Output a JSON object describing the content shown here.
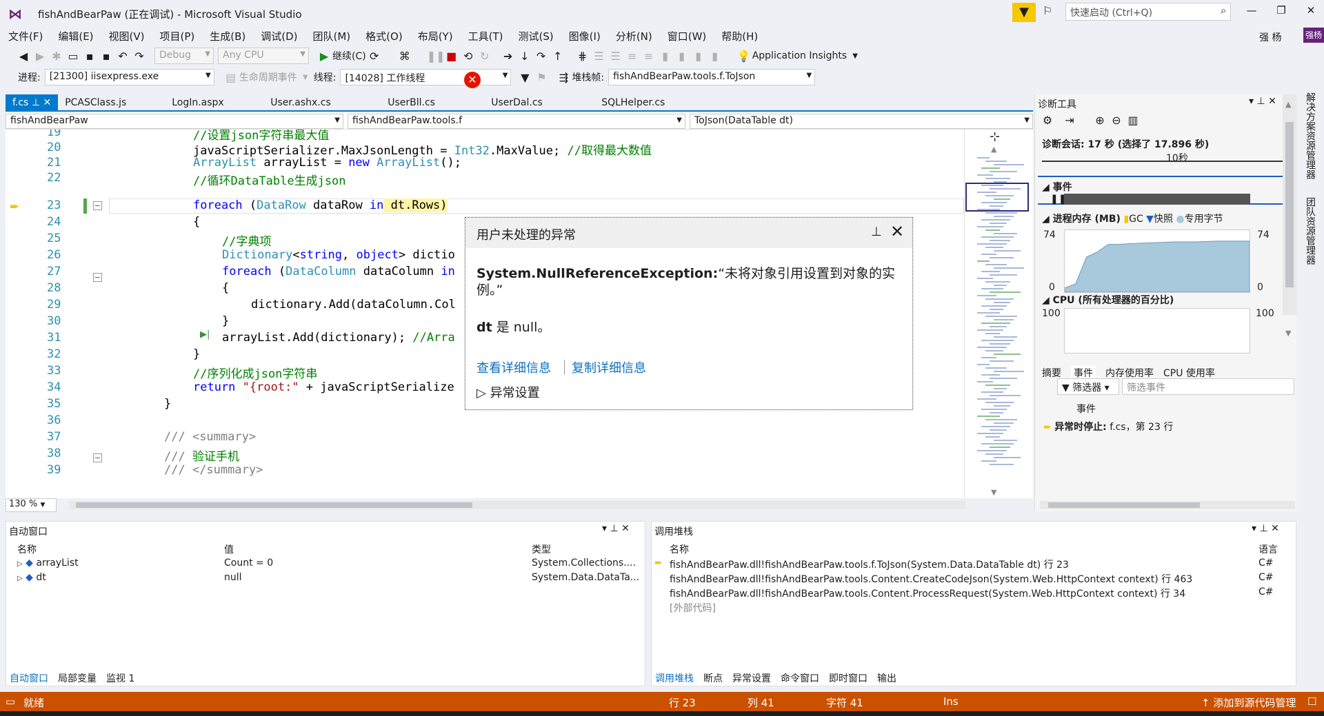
{
  "window": {
    "title": "fishAndBearPaw (正在调试) - Microsoft Visual Studio",
    "quick_launch_placeholder": "快速启动 (Ctrl+Q)",
    "user": "强 杨",
    "user_badge": "强杨"
  },
  "menu": [
    "文件(F)",
    "编辑(E)",
    "视图(V)",
    "项目(P)",
    "生成(B)",
    "调试(D)",
    "团队(M)",
    "格式(O)",
    "布局(Y)",
    "工具(T)",
    "测试(S)",
    "图像(I)",
    "分析(N)",
    "窗口(W)",
    "帮助(H)"
  ],
  "toolbar": {
    "config": "Debug",
    "platform": "Any CPU",
    "continue_label": "继续(C)",
    "app_insights": "Application Insights",
    "process_label": "进程:",
    "process_value": "[21300] iisexpress.exe",
    "lifecycle_label": "生命周期事件",
    "thread_label": "线程:",
    "thread_value": "[14028] 工作线程",
    "stack_label": "堆栈帧:",
    "stack_value": "fishAndBearPaw.tools.f.ToJson"
  },
  "doc_tabs": [
    "f.cs",
    "PCASClass.js",
    "LogIn.aspx",
    "User.ashx.cs",
    "UserBll.cs",
    "UserDal.cs",
    "SQLHelper.cs"
  ],
  "nav": {
    "project": "fishAndBearPaw",
    "class": "fishAndBearPaw.tools.f",
    "member": "ToJson(DataTable dt)"
  },
  "editor": {
    "zoom": "130 %",
    "line_numbers": [
      "19",
      "20",
      "21",
      "22",
      "23",
      "24",
      "25",
      "26",
      "27",
      "28",
      "29",
      "30",
      "31",
      "32",
      "33",
      "34",
      "35",
      "36",
      "37",
      "38",
      "39"
    ],
    "lines": {
      "l19": "//设置json字符串最大值",
      "l20a": "javaScriptSerializer.MaxJsonLength = ",
      "l20b": "Int32",
      "l20c": ".MaxValue; ",
      "l20d": "//取得最大数值",
      "l21a": "ArrayList",
      "l21b": " arrayList = ",
      "l21c": "new",
      "l21d": " ",
      "l21e": "ArrayList",
      "l21f": "();",
      "l22": "//循环DataTable生成json",
      "l23a": "foreach",
      "l23b": " (",
      "l23c": "DataRow",
      "l23d": " dataRow ",
      "l23e": "in",
      "l23f": " dt.Rows)",
      "l24": "{",
      "l25": "//字典项",
      "l26a": "Dictionary",
      "l26b": "<",
      "l26c": "string",
      "l26d": ", ",
      "l26e": "object",
      "l26f": "> dictio",
      "l27a": "foreach",
      "l27b": " (",
      "l27c": "DataColumn",
      "l27d": " dataColumn ",
      "l27e": "in",
      "l28": "{",
      "l29": "dictionary.Add(dataColumn.Col",
      "l30": "}",
      "l31a": "arrayList.Add(dictionary); ",
      "l31b": "//Arra",
      "l32": "}",
      "l33": "//序列化成json字符串",
      "l34a": "return",
      "l34b": " ",
      "l34c": "\"{root:\"",
      "l34d": " + javaScriptSerialize",
      "l35": "}",
      "l37a": "/// ",
      "l37b": "<summary>",
      "l38a": "/// ",
      "l38b": "验证手机",
      "l39a": "/// ",
      "l39b": "</summary>"
    }
  },
  "exception": {
    "title": "用户未处理的异常",
    "name": "System.NullReferenceException:",
    "message": "“未将对象引用设置到对象的实例。”",
    "detail_bold": "dt",
    "detail_rest": " 是 null。",
    "link_details": "查看详细信息",
    "link_copy": "复制详细信息",
    "settings": "异常设置"
  },
  "diagnostics": {
    "title": "诊断工具",
    "session": "诊断会话: 17 秒 (选择了 17.896 秒)",
    "tick_label": "10秒",
    "events_label": "事件",
    "memory_label": "进程内存 (MB)",
    "legend_gc": "GC",
    "legend_snapshot": "快照",
    "legend_private": "专用字节",
    "cpu_label": "CPU (所有处理器的百分比)",
    "tabs": [
      "摘要",
      "事件",
      "内存使用率",
      "CPU 使用率"
    ],
    "filter_label": "筛选器",
    "filter_placeholder": "筛选事件",
    "event_col": "事件",
    "event_row_bold": "异常时停止:",
    "event_row_rest": " f.cs，第 23 行",
    "colors": {
      "memory_fill": "#a8c8dc",
      "gc": "#f0c800",
      "snapshot": "#1c5fbd"
    }
  },
  "chart_data": [
    {
      "type": "area",
      "title": "进程内存 (MB)",
      "ylim": [
        0,
        74
      ],
      "y_ticks": [
        "74",
        "0"
      ],
      "x": [
        0,
        1,
        2,
        3,
        4,
        5,
        6,
        8,
        10,
        12,
        14,
        16,
        17
      ],
      "values": [
        5,
        10,
        42,
        48,
        57,
        57,
        58,
        59,
        60,
        60,
        61,
        61,
        61
      ],
      "series": [
        {
          "name": "专用字节",
          "values": [
            5,
            10,
            42,
            48,
            57,
            57,
            58,
            59,
            60,
            60,
            61,
            61,
            61
          ]
        }
      ]
    },
    {
      "type": "line",
      "title": "CPU (所有处理器的百分比)",
      "ylim": [
        0,
        100
      ],
      "y_ticks": [
        "100"
      ],
      "values": []
    }
  ],
  "vertical_tabs": [
    "解决方案资源管理器",
    "团队资源管理器"
  ],
  "autos": {
    "title": "自动窗口",
    "columns": [
      "名称",
      "值",
      "类型"
    ],
    "rows": [
      {
        "name": "arrayList",
        "value": "Count = 0",
        "type": "System.Collections...."
      },
      {
        "name": "dt",
        "value": "null",
        "type": "System.Data.DataTa..."
      }
    ],
    "tabs": [
      "自动窗口",
      "局部变量",
      "监视 1"
    ]
  },
  "callstack": {
    "title": "调用堆栈",
    "columns": [
      "名称",
      "语言"
    ],
    "rows": [
      {
        "name": "fishAndBearPaw.dll!fishAndBearPaw.tools.f.ToJson(System.Data.DataTable dt) 行 23",
        "lang": "C#"
      },
      {
        "name": "fishAndBearPaw.dll!fishAndBearPaw.tools.Content.CreateCodeJson(System.Web.HttpContext context) 行 463",
        "lang": "C#"
      },
      {
        "name": "fishAndBearPaw.dll!fishAndBearPaw.tools.Content.ProcessRequest(System.Web.HttpContext context) 行 34",
        "lang": "C#"
      },
      {
        "name": "[外部代码]",
        "lang": ""
      }
    ],
    "tabs": [
      "调用堆栈",
      "断点",
      "异常设置",
      "命令窗口",
      "即时窗口",
      "输出"
    ]
  },
  "status": {
    "ready": "就绪",
    "line": "行 23",
    "col": "列 41",
    "char": "字符 41",
    "mode": "Ins",
    "source_control": "添加到源代码管理",
    "bg_color": "#ca5100"
  }
}
